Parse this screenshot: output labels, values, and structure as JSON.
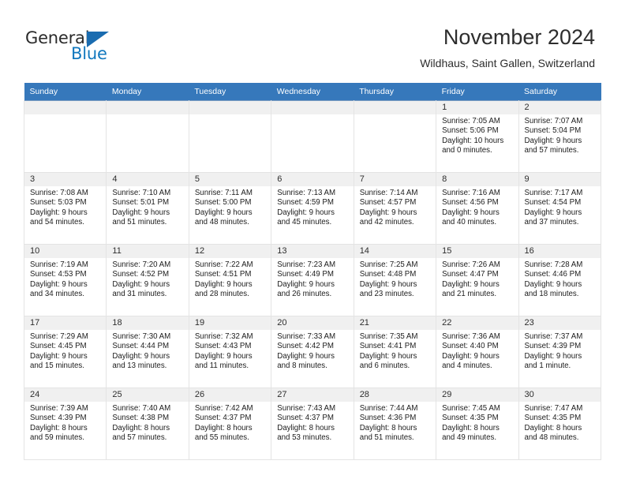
{
  "brand": {
    "name_part1": "General",
    "name_part2": "Blue",
    "triangle_icon": "triangle-logo-icon",
    "color_dark": "#2b2b2b",
    "color_blue": "#1278be"
  },
  "header": {
    "title": "November 2024",
    "subtitle": "Wildhaus, Saint Gallen, Switzerland",
    "accent_color": "#3678bb",
    "daynum_band_color": "#f0f0f0"
  },
  "weekdays": [
    "Sunday",
    "Monday",
    "Tuesday",
    "Wednesday",
    "Thursday",
    "Friday",
    "Saturday"
  ],
  "weeks": [
    [
      {
        "day": "",
        "empty": true
      },
      {
        "day": "",
        "empty": true
      },
      {
        "day": "",
        "empty": true
      },
      {
        "day": "",
        "empty": true
      },
      {
        "day": "",
        "empty": true
      },
      {
        "day": "1",
        "sunrise": "Sunrise: 7:05 AM",
        "sunset": "Sunset: 5:06 PM",
        "daylight1": "Daylight: 10 hours",
        "daylight2": "and 0 minutes."
      },
      {
        "day": "2",
        "sunrise": "Sunrise: 7:07 AM",
        "sunset": "Sunset: 5:04 PM",
        "daylight1": "Daylight: 9 hours",
        "daylight2": "and 57 minutes."
      }
    ],
    [
      {
        "day": "3",
        "sunrise": "Sunrise: 7:08 AM",
        "sunset": "Sunset: 5:03 PM",
        "daylight1": "Daylight: 9 hours",
        "daylight2": "and 54 minutes."
      },
      {
        "day": "4",
        "sunrise": "Sunrise: 7:10 AM",
        "sunset": "Sunset: 5:01 PM",
        "daylight1": "Daylight: 9 hours",
        "daylight2": "and 51 minutes."
      },
      {
        "day": "5",
        "sunrise": "Sunrise: 7:11 AM",
        "sunset": "Sunset: 5:00 PM",
        "daylight1": "Daylight: 9 hours",
        "daylight2": "and 48 minutes."
      },
      {
        "day": "6",
        "sunrise": "Sunrise: 7:13 AM",
        "sunset": "Sunset: 4:59 PM",
        "daylight1": "Daylight: 9 hours",
        "daylight2": "and 45 minutes."
      },
      {
        "day": "7",
        "sunrise": "Sunrise: 7:14 AM",
        "sunset": "Sunset: 4:57 PM",
        "daylight1": "Daylight: 9 hours",
        "daylight2": "and 42 minutes."
      },
      {
        "day": "8",
        "sunrise": "Sunrise: 7:16 AM",
        "sunset": "Sunset: 4:56 PM",
        "daylight1": "Daylight: 9 hours",
        "daylight2": "and 40 minutes."
      },
      {
        "day": "9",
        "sunrise": "Sunrise: 7:17 AM",
        "sunset": "Sunset: 4:54 PM",
        "daylight1": "Daylight: 9 hours",
        "daylight2": "and 37 minutes."
      }
    ],
    [
      {
        "day": "10",
        "sunrise": "Sunrise: 7:19 AM",
        "sunset": "Sunset: 4:53 PM",
        "daylight1": "Daylight: 9 hours",
        "daylight2": "and 34 minutes."
      },
      {
        "day": "11",
        "sunrise": "Sunrise: 7:20 AM",
        "sunset": "Sunset: 4:52 PM",
        "daylight1": "Daylight: 9 hours",
        "daylight2": "and 31 minutes."
      },
      {
        "day": "12",
        "sunrise": "Sunrise: 7:22 AM",
        "sunset": "Sunset: 4:51 PM",
        "daylight1": "Daylight: 9 hours",
        "daylight2": "and 28 minutes."
      },
      {
        "day": "13",
        "sunrise": "Sunrise: 7:23 AM",
        "sunset": "Sunset: 4:49 PM",
        "daylight1": "Daylight: 9 hours",
        "daylight2": "and 26 minutes."
      },
      {
        "day": "14",
        "sunrise": "Sunrise: 7:25 AM",
        "sunset": "Sunset: 4:48 PM",
        "daylight1": "Daylight: 9 hours",
        "daylight2": "and 23 minutes."
      },
      {
        "day": "15",
        "sunrise": "Sunrise: 7:26 AM",
        "sunset": "Sunset: 4:47 PM",
        "daylight1": "Daylight: 9 hours",
        "daylight2": "and 21 minutes."
      },
      {
        "day": "16",
        "sunrise": "Sunrise: 7:28 AM",
        "sunset": "Sunset: 4:46 PM",
        "daylight1": "Daylight: 9 hours",
        "daylight2": "and 18 minutes."
      }
    ],
    [
      {
        "day": "17",
        "sunrise": "Sunrise: 7:29 AM",
        "sunset": "Sunset: 4:45 PM",
        "daylight1": "Daylight: 9 hours",
        "daylight2": "and 15 minutes."
      },
      {
        "day": "18",
        "sunrise": "Sunrise: 7:30 AM",
        "sunset": "Sunset: 4:44 PM",
        "daylight1": "Daylight: 9 hours",
        "daylight2": "and 13 minutes."
      },
      {
        "day": "19",
        "sunrise": "Sunrise: 7:32 AM",
        "sunset": "Sunset: 4:43 PM",
        "daylight1": "Daylight: 9 hours",
        "daylight2": "and 11 minutes."
      },
      {
        "day": "20",
        "sunrise": "Sunrise: 7:33 AM",
        "sunset": "Sunset: 4:42 PM",
        "daylight1": "Daylight: 9 hours",
        "daylight2": "and 8 minutes."
      },
      {
        "day": "21",
        "sunrise": "Sunrise: 7:35 AM",
        "sunset": "Sunset: 4:41 PM",
        "daylight1": "Daylight: 9 hours",
        "daylight2": "and 6 minutes."
      },
      {
        "day": "22",
        "sunrise": "Sunrise: 7:36 AM",
        "sunset": "Sunset: 4:40 PM",
        "daylight1": "Daylight: 9 hours",
        "daylight2": "and 4 minutes."
      },
      {
        "day": "23",
        "sunrise": "Sunrise: 7:37 AM",
        "sunset": "Sunset: 4:39 PM",
        "daylight1": "Daylight: 9 hours",
        "daylight2": "and 1 minute."
      }
    ],
    [
      {
        "day": "24",
        "sunrise": "Sunrise: 7:39 AM",
        "sunset": "Sunset: 4:39 PM",
        "daylight1": "Daylight: 8 hours",
        "daylight2": "and 59 minutes."
      },
      {
        "day": "25",
        "sunrise": "Sunrise: 7:40 AM",
        "sunset": "Sunset: 4:38 PM",
        "daylight1": "Daylight: 8 hours",
        "daylight2": "and 57 minutes."
      },
      {
        "day": "26",
        "sunrise": "Sunrise: 7:42 AM",
        "sunset": "Sunset: 4:37 PM",
        "daylight1": "Daylight: 8 hours",
        "daylight2": "and 55 minutes."
      },
      {
        "day": "27",
        "sunrise": "Sunrise: 7:43 AM",
        "sunset": "Sunset: 4:37 PM",
        "daylight1": "Daylight: 8 hours",
        "daylight2": "and 53 minutes."
      },
      {
        "day": "28",
        "sunrise": "Sunrise: 7:44 AM",
        "sunset": "Sunset: 4:36 PM",
        "daylight1": "Daylight: 8 hours",
        "daylight2": "and 51 minutes."
      },
      {
        "day": "29",
        "sunrise": "Sunrise: 7:45 AM",
        "sunset": "Sunset: 4:35 PM",
        "daylight1": "Daylight: 8 hours",
        "daylight2": "and 49 minutes."
      },
      {
        "day": "30",
        "sunrise": "Sunrise: 7:47 AM",
        "sunset": "Sunset: 4:35 PM",
        "daylight1": "Daylight: 8 hours",
        "daylight2": "and 48 minutes."
      }
    ]
  ]
}
